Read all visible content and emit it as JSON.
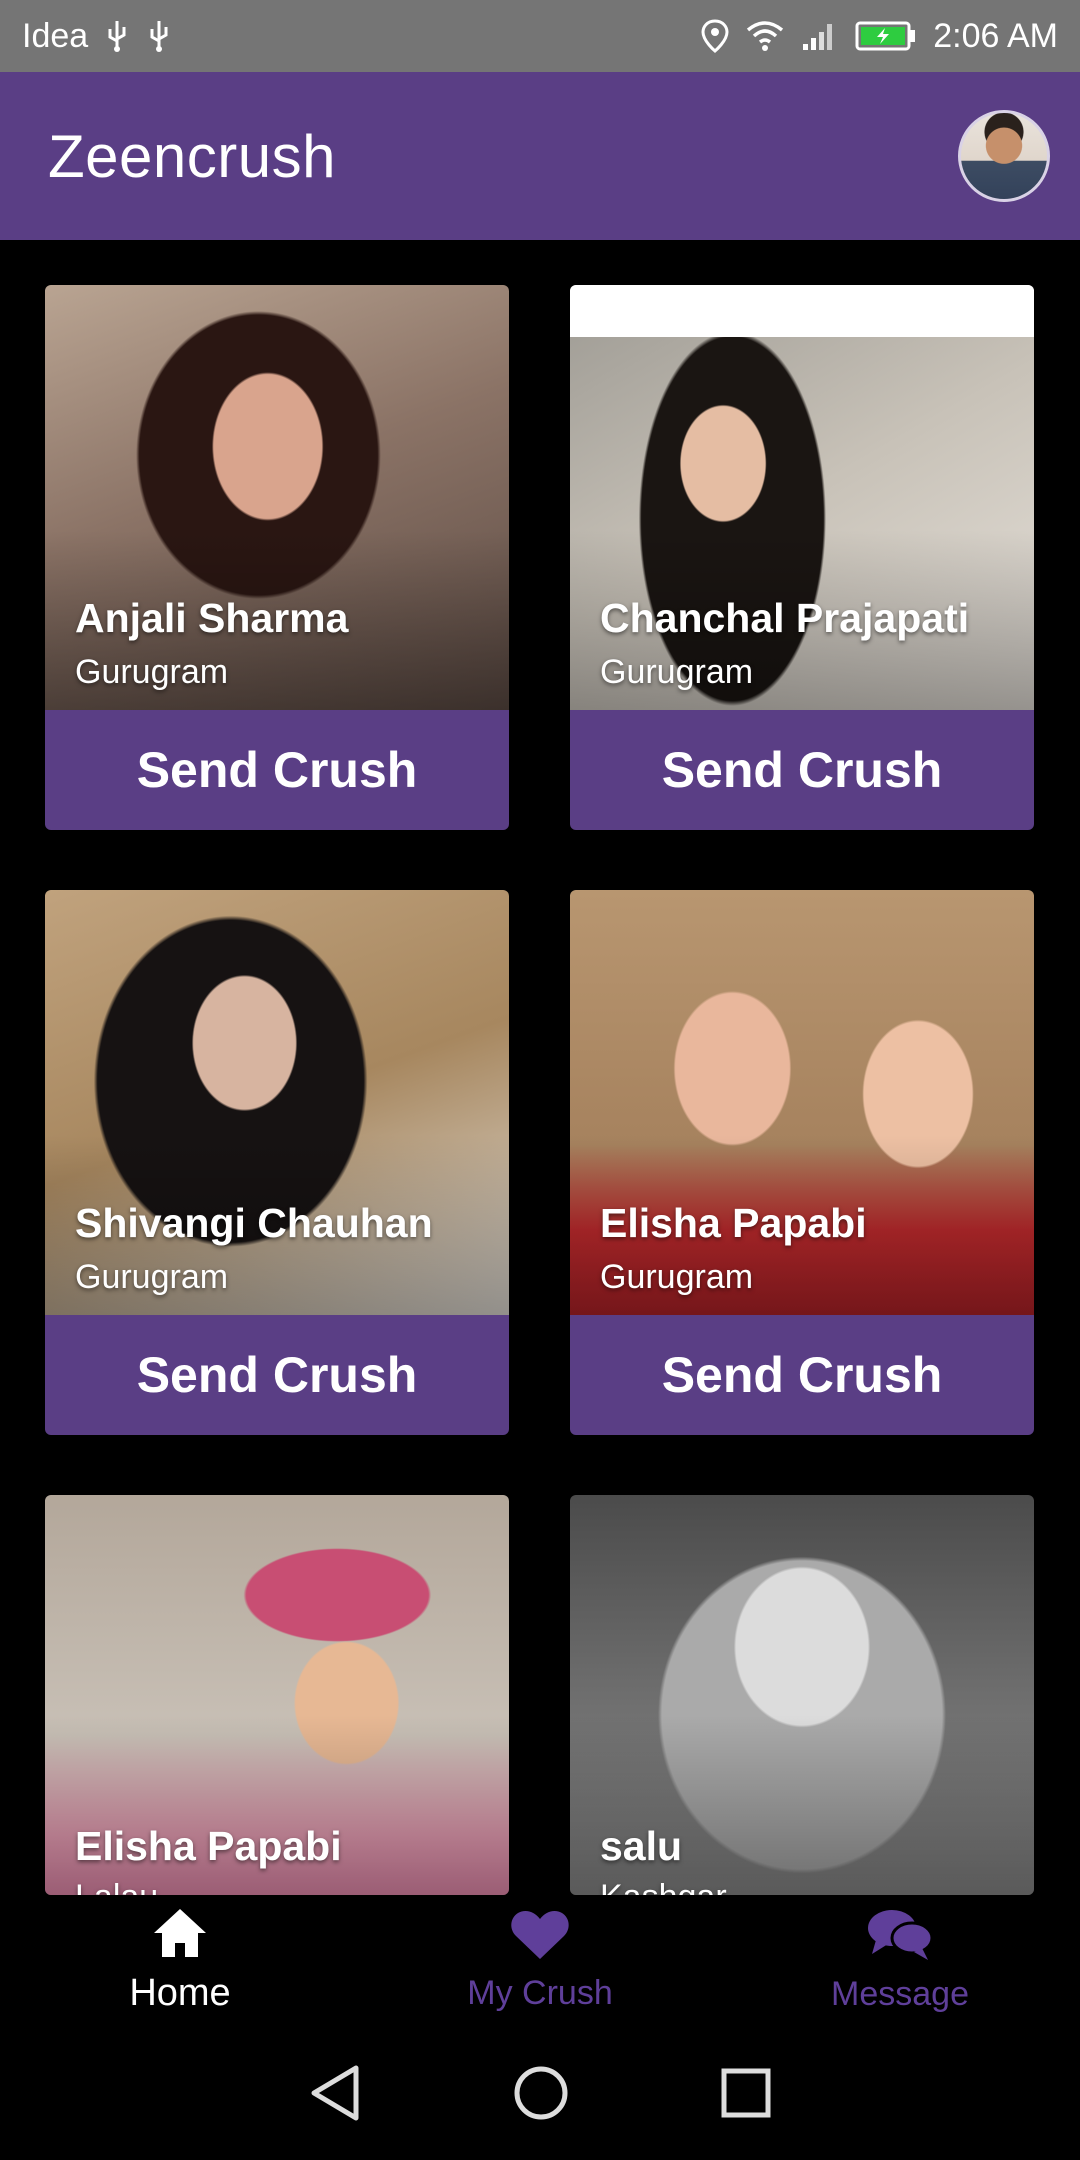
{
  "status_bar": {
    "carrier": "Idea",
    "time": "2:06 AM",
    "icons": [
      "usb-icon",
      "usb-icon",
      "location-icon",
      "wifi-icon",
      "signal-icon",
      "battery-icon"
    ],
    "battery_color": "#2ecc40"
  },
  "app_bar": {
    "title": "Zeencrush",
    "color": "#5a3e85"
  },
  "profiles": [
    {
      "name": "Anjali Sharma",
      "city": "Gurugram",
      "button": "Send Crush"
    },
    {
      "name": "Chanchal Prajapati",
      "city": "Gurugram",
      "button": "Send Crush"
    },
    {
      "name": "Shivangi Chauhan",
      "city": "Gurugram",
      "button": "Send Crush"
    },
    {
      "name": "Elisha Papabi",
      "city": "Gurugram",
      "button": "Send Crush"
    },
    {
      "name": "Elisha Papabi",
      "city": "Lalau"
    },
    {
      "name": "salu",
      "city": "Kashgar"
    }
  ],
  "bottom_nav": {
    "items": [
      {
        "label": "Home",
        "icon": "home-icon",
        "active": true
      },
      {
        "label": "My Crush",
        "icon": "heart-icon",
        "active": false
      },
      {
        "label": "Message",
        "icon": "chat-icon",
        "active": false
      }
    ],
    "active_color": "#ffffff",
    "inactive_color": "#5f3f9a"
  },
  "system_nav": [
    "back-icon",
    "home-circle-icon",
    "recents-icon"
  ]
}
